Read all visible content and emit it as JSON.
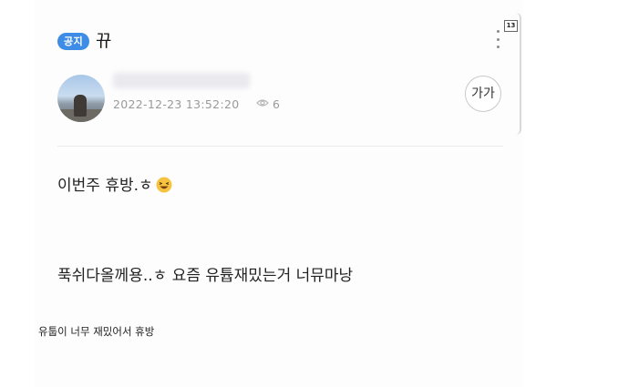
{
  "header": {
    "badge": "공지",
    "title": "뀨",
    "page_badge": "13"
  },
  "author": {
    "timestamp": "2022-12-23 13:52:20",
    "views": "6"
  },
  "controls": {
    "font_size_label": "가가"
  },
  "body": {
    "line1": "이번주 휴방.ㅎ",
    "line2": "푹쉬다올께용..ㅎ 요즘 유튭재밌는거 너뮤마낭"
  },
  "caption": "유툽이 너무 재밌어서 휴방",
  "colors": {
    "badge_blue": "#3d8ce6",
    "meta_gray": "#9a9a9a",
    "emoji_yellow": "#f5c242"
  },
  "icons": {
    "more": "more-vertical-icon",
    "views": "eye-icon",
    "emoji": "laughing-emoji-icon"
  }
}
